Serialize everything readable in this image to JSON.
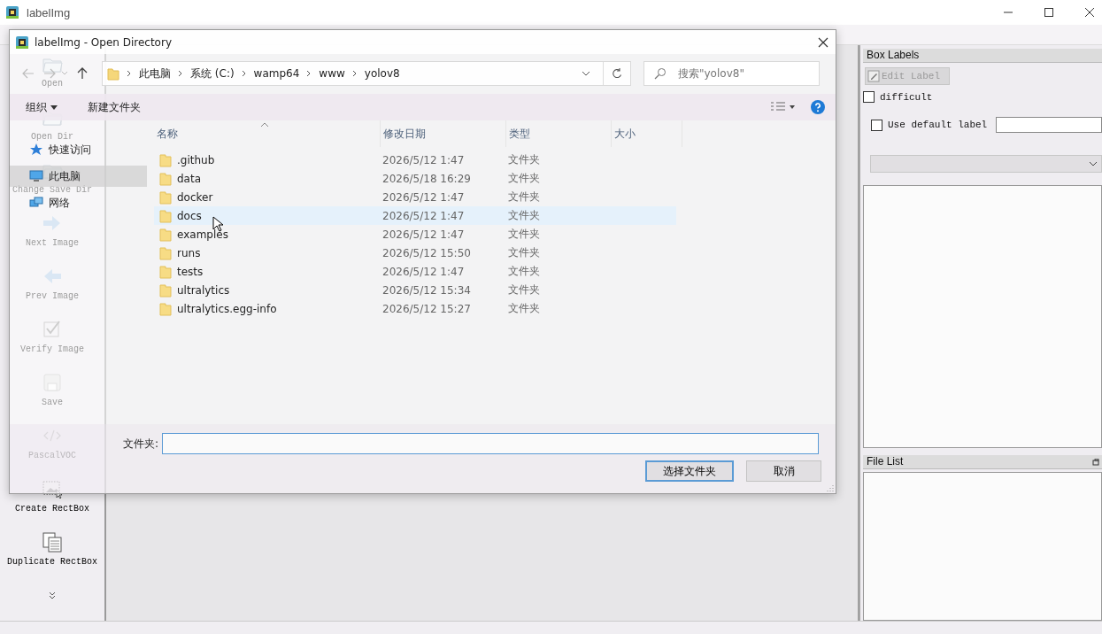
{
  "app": {
    "title": "labelImg"
  },
  "toolbar": [
    {
      "label": "Open",
      "kind": "folder"
    },
    {
      "label": "Open Dir",
      "kind": "folder"
    },
    {
      "label": "Change Save Dir",
      "kind": "folder"
    },
    {
      "label": "Next Image",
      "kind": "next"
    },
    {
      "label": "Prev Image",
      "kind": "prev"
    },
    {
      "label": "Verify Image",
      "kind": "verify"
    },
    {
      "label": "Save",
      "kind": "save"
    },
    {
      "label": "PascalVOC",
      "kind": "code"
    },
    {
      "label": "Create RectBox",
      "kind": "rect"
    },
    {
      "label": "Duplicate RectBox",
      "kind": "duplicate"
    }
  ],
  "dialog": {
    "title": "labelImg - Open Directory",
    "path": [
      "此电脑",
      "系统 (C:)",
      "wamp64",
      "www",
      "yolov8"
    ],
    "search": {
      "placeholder": "搜索\"yolov8\""
    },
    "commands": [
      {
        "label": "组织",
        "dropdown": true
      },
      {
        "label": "新建文件夹",
        "dropdown": false
      }
    ],
    "nav": [
      {
        "label": "快速访问",
        "kind": "star",
        "selected": false
      },
      {
        "label": "此电脑",
        "kind": "computer",
        "selected": true
      },
      {
        "label": "网络",
        "kind": "network",
        "selected": false
      }
    ],
    "columns": [
      "名称",
      "修改日期",
      "类型",
      "大小"
    ],
    "rows": [
      {
        "name": ".github",
        "modified": "2026/5/12 1:47",
        "type": "文件夹",
        "hovered": false
      },
      {
        "name": "data",
        "modified": "2026/5/18 16:29",
        "type": "文件夹",
        "hovered": false
      },
      {
        "name": "docker",
        "modified": "2026/5/12 1:47",
        "type": "文件夹",
        "hovered": false
      },
      {
        "name": "docs",
        "modified": "2026/5/12 1:47",
        "type": "文件夹",
        "hovered": true
      },
      {
        "name": "examples",
        "modified": "2026/5/12 1:47",
        "type": "文件夹",
        "hovered": false
      },
      {
        "name": "runs",
        "modified": "2026/5/12 15:50",
        "type": "文件夹",
        "hovered": false
      },
      {
        "name": "tests",
        "modified": "2026/5/12 1:47",
        "type": "文件夹",
        "hovered": false
      },
      {
        "name": "ultralytics",
        "modified": "2026/5/12 15:34",
        "type": "文件夹",
        "hovered": false
      },
      {
        "name": "ultralytics.egg-info",
        "modified": "2026/5/12 15:27",
        "type": "文件夹",
        "hovered": false
      }
    ],
    "folder_field": {
      "label": "文件夹:"
    },
    "buttons": [
      {
        "label": "选择文件夹",
        "default": true
      },
      {
        "label": "取消",
        "default": false
      }
    ]
  },
  "dock": {
    "box_labels": {
      "title": "Box Labels",
      "edit_button": {
        "label": "Edit Label",
        "disabled": true
      },
      "difficult": {
        "label": "difficult",
        "checked": false
      },
      "use_default": {
        "label": "Use default label",
        "checked": false
      }
    },
    "file_list": {
      "title": "File List"
    }
  }
}
